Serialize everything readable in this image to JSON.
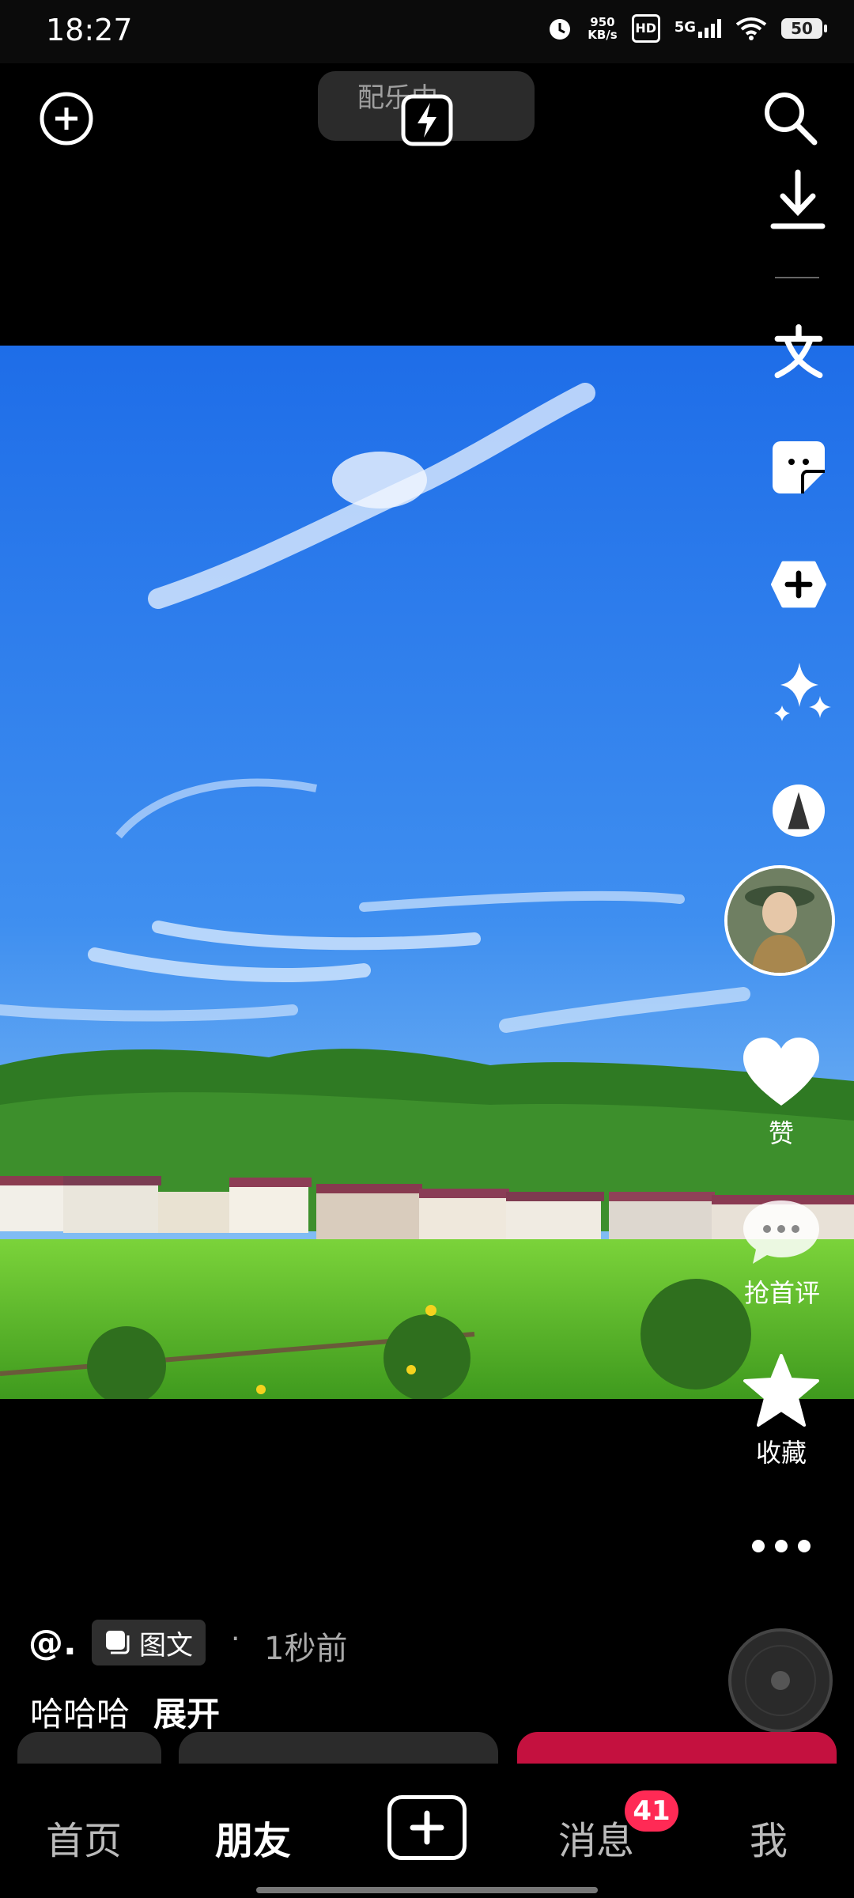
{
  "status_bar": {
    "time": "18:27",
    "net_speed_value": "950",
    "net_speed_unit": "KB/s",
    "hd_label": "HD",
    "network": "5G",
    "battery": "50"
  },
  "top": {
    "music_label": "配乐中"
  },
  "side_actions": {
    "like_label": "赞",
    "comment_label": "抢首评",
    "favorite_label": "收藏"
  },
  "post": {
    "author": "@.",
    "type_tag": "图文",
    "separator": "·",
    "time_ago": "1秒前",
    "caption": "哈哈哈",
    "expand_label": "展开"
  },
  "nav": {
    "home": "首页",
    "friends": "朋友",
    "messages": "消息",
    "messages_badge": "41",
    "me": "我"
  },
  "colors": {
    "badge": "#ff2a55",
    "sky": "#2e7df0",
    "accent_bar": "#c4113f"
  },
  "icons": [
    "add-circle-icon",
    "flash-icon",
    "search-icon",
    "download-icon",
    "text-icon",
    "sticker-icon",
    "effects-icon",
    "sparkle-icon",
    "filter-icon",
    "heart-icon",
    "comment-icon",
    "star-icon",
    "more-icon",
    "music-disc-icon"
  ]
}
